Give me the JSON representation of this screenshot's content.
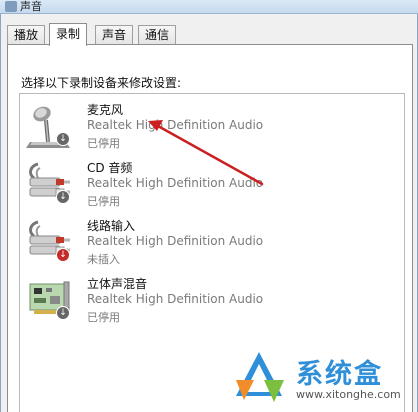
{
  "window": {
    "title": "声音"
  },
  "tabs": [
    {
      "label": "播放"
    },
    {
      "label": "录制"
    },
    {
      "label": "声音"
    },
    {
      "label": "通信"
    }
  ],
  "instruction": "选择以下录制设备来修改设置:",
  "devices": [
    {
      "name": "麦克风",
      "description": "Realtek High Definition Audio",
      "status": "已停用",
      "icon": "microphone-icon"
    },
    {
      "name": "CD 音频",
      "description": "Realtek High Definition Audio",
      "status": "已停用",
      "icon": "audio-cable-icon"
    },
    {
      "name": "线路输入",
      "description": "Realtek High Definition Audio",
      "status": "未插入",
      "icon": "audio-cable-icon"
    },
    {
      "name": "立体声混音",
      "description": "Realtek High Definition Audio",
      "status": "已停用",
      "icon": "sound-card-icon"
    }
  ],
  "annotation": {
    "color": "#cc1f1f"
  },
  "watermark": {
    "title": "系统盒",
    "url": "www.xitonghe.com"
  }
}
